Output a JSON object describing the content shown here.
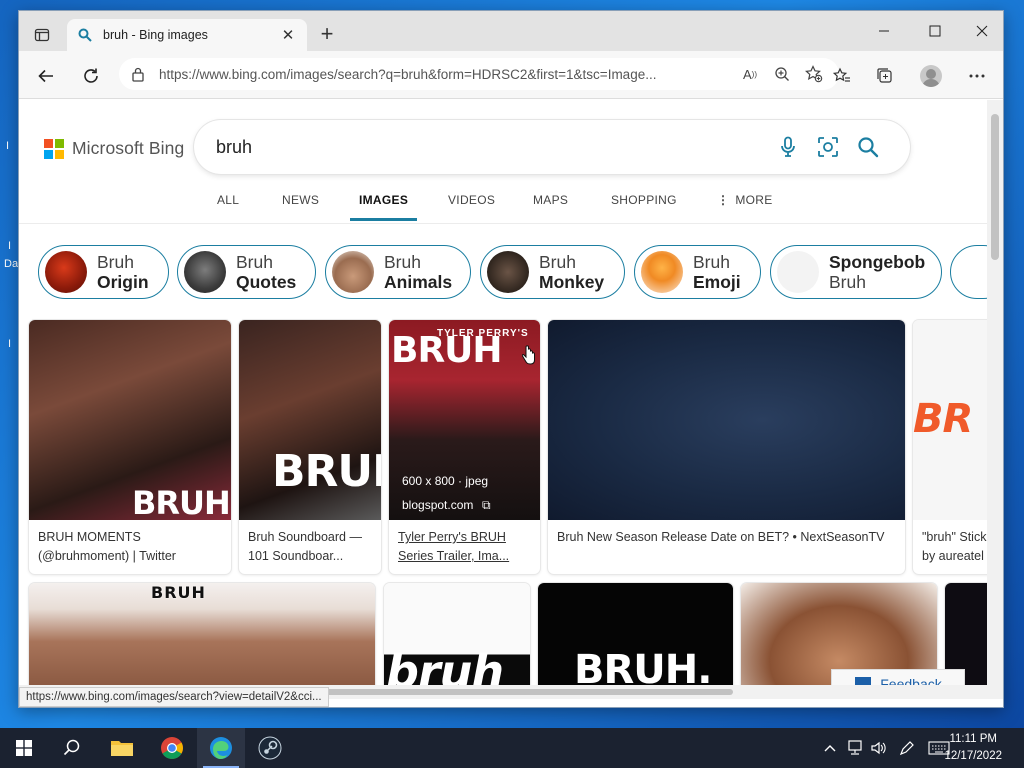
{
  "desktop": {
    "glyph1": "I",
    "glyph2": "I",
    "glyph3": "Da",
    "glyph4": "I"
  },
  "browser": {
    "tab_title": "bruh - Bing images",
    "new_tab": "+",
    "url": "https://www.bing.com/images/search?q=bruh&form=HDRSC2&first=1&tsc=Image...",
    "status_url": "https://www.bing.com/images/search?view=detailV2&cci..."
  },
  "bing": {
    "logo_text": "Microsoft Bing",
    "logo_colors": [
      "#f25022",
      "#7fba00",
      "#00a4ef",
      "#ffb900"
    ],
    "query": "bruh",
    "accent": "#1b7ea1",
    "scopes": [
      "ALL",
      "NEWS",
      "IMAGES",
      "VIDEOS",
      "MAPS",
      "SHOPPING"
    ],
    "more_label": "MORE",
    "active_scope": "IMAGES"
  },
  "pills": [
    {
      "top": "Bruh",
      "bottom": "Origin"
    },
    {
      "top": "Bruh",
      "bottom": "Quotes"
    },
    {
      "top": "Bruh",
      "bottom": "Animals"
    },
    {
      "top": "Bruh",
      "bottom": "Monkey"
    },
    {
      "top": "Bruh",
      "bottom": "Emoji"
    },
    {
      "top": "Spongebob",
      "bottom": "Bruh"
    }
  ],
  "results": [
    {
      "caption1": "BRUH MOMENTS",
      "caption2": "(@bruhmoment) | Twitter",
      "img_text": "BRUH"
    },
    {
      "caption1": "Bruh Soundboard —",
      "caption2": "101 Soundboar...",
      "img_text": "BRUH"
    },
    {
      "caption1": "Tyler Perry's BRUH",
      "caption2": "Series Trailer, Ima...",
      "img_text": "BRUH",
      "series_label": "TYLER PERRY'S",
      "size": "600 x 800 · jpeg",
      "source": "blogspot.com"
    },
    {
      "caption1": "Bruh New Season Release Date on BET? • NextSeasonTV"
    },
    {
      "caption1": "\"bruh\" Stick",
      "caption2": "by aureatel",
      "img_text": "BR"
    }
  ],
  "row2": {
    "img1_text": "BRUH",
    "img2_text": "bruh",
    "img3_text": "BRUH."
  },
  "feedback_label": "Feedback",
  "taskbar": {
    "time": "11:11 PM",
    "date": "12/17/2022"
  }
}
